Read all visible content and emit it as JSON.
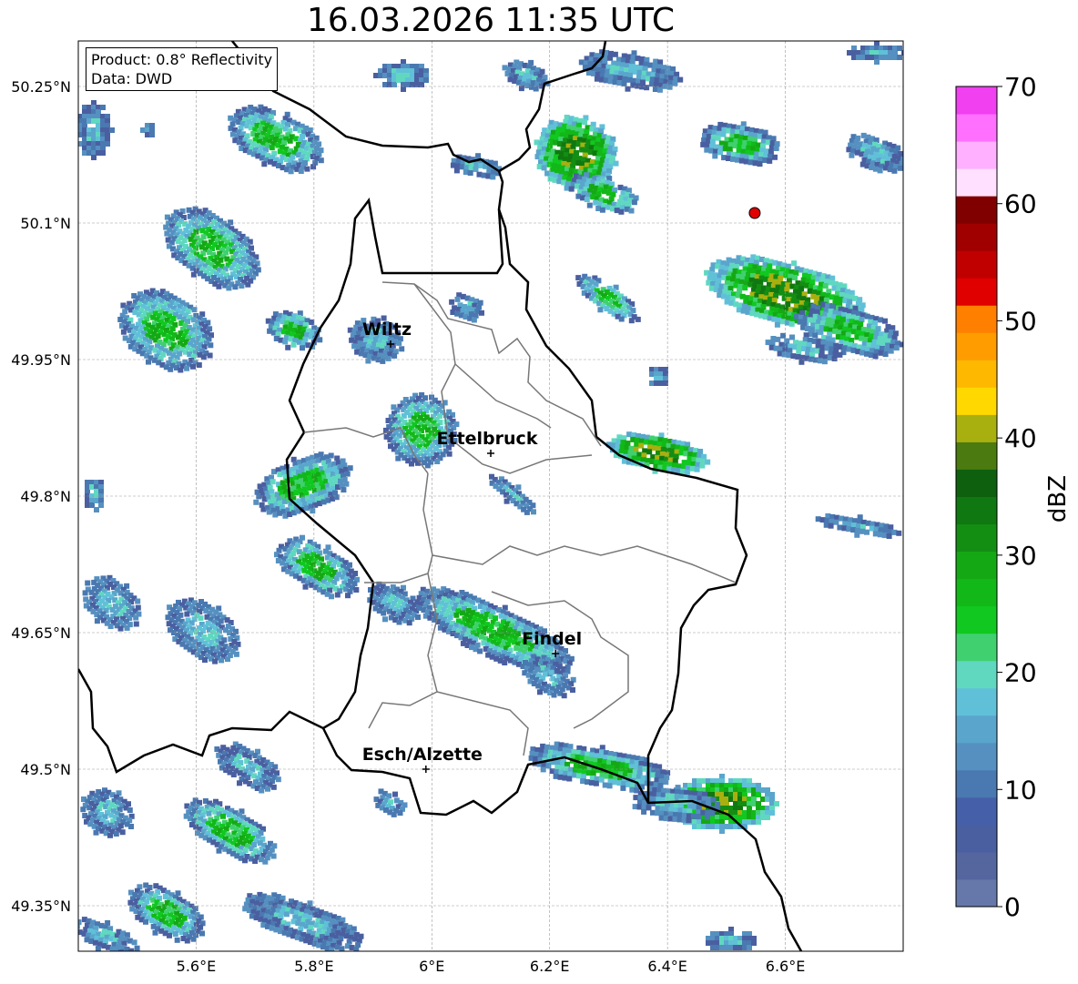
{
  "title": "16.03.2026 11:35 UTC",
  "info": {
    "product": "Product: 0.8° Reflectivity",
    "data": "Data: DWD"
  },
  "map": {
    "lon_range": [
      5.4,
      6.8
    ],
    "lat_range": [
      49.3,
      50.3
    ],
    "lat_ticks": [
      {
        "value": 50.25,
        "label": "50.25°N"
      },
      {
        "value": 50.1,
        "label": "50.1°N"
      },
      {
        "value": 49.95,
        "label": "49.95°N"
      },
      {
        "value": 49.8,
        "label": "49.8°N"
      },
      {
        "value": 49.65,
        "label": "49.65°N"
      },
      {
        "value": 49.5,
        "label": "49.5°N"
      },
      {
        "value": 49.35,
        "label": "49.35°N"
      }
    ],
    "lon_ticks": [
      {
        "value": 5.6,
        "label": "5.6°E"
      },
      {
        "value": 5.8,
        "label": "5.8°E"
      },
      {
        "value": 6.0,
        "label": "6°E"
      },
      {
        "value": 6.2,
        "label": "6.2°E"
      },
      {
        "value": 6.4,
        "label": "6.4°E"
      },
      {
        "value": 6.6,
        "label": "6.6°E"
      }
    ],
    "grid": true,
    "cities": [
      {
        "name": "Wiltz",
        "lon": 5.93,
        "lat": 49.967
      },
      {
        "name": "Ettelbruck",
        "lon": 6.1,
        "lat": 49.847
      },
      {
        "name": "Findel",
        "lon": 6.21,
        "lat": 49.627
      },
      {
        "name": "Esch/Alzette",
        "lon": 5.99,
        "lat": 49.5
      }
    ],
    "radar_site": {
      "lon": 6.548,
      "lat": 50.111,
      "color": "#e00000"
    }
  },
  "colorbar": {
    "label": "dBZ",
    "min": 0,
    "max": 70,
    "ticks": [
      0,
      10,
      20,
      30,
      40,
      50,
      60,
      70
    ],
    "colors": [
      "#6677aa",
      "#55669f",
      "#4a5fa0",
      "#4560a8",
      "#4a78b0",
      "#5590c0",
      "#5aa5cc",
      "#60c0d8",
      "#60d8c0",
      "#40d070",
      "#10c820",
      "#12b818",
      "#15a815",
      "#138e13",
      "#107810",
      "#0e600e",
      "#4a7a10",
      "#a8b010",
      "#ffd800",
      "#ffb800",
      "#ff9c00",
      "#ff8000",
      "#e00000",
      "#c00000",
      "#a00000",
      "#800000",
      "#ffe0ff",
      "#ffb0ff",
      "#ff70ff",
      "#f040f0"
    ]
  },
  "echo_colors": {
    "weak": [
      "#4a5fa0",
      "#4a78b0",
      "#5590c0"
    ],
    "mid": [
      "#5aa5cc",
      "#60c0d8",
      "#60d8c0"
    ],
    "strong": [
      "#40d070",
      "#10c820",
      "#12b818",
      "#15a815"
    ],
    "core": [
      "#138e13",
      "#107810",
      "#a8b010"
    ]
  }
}
